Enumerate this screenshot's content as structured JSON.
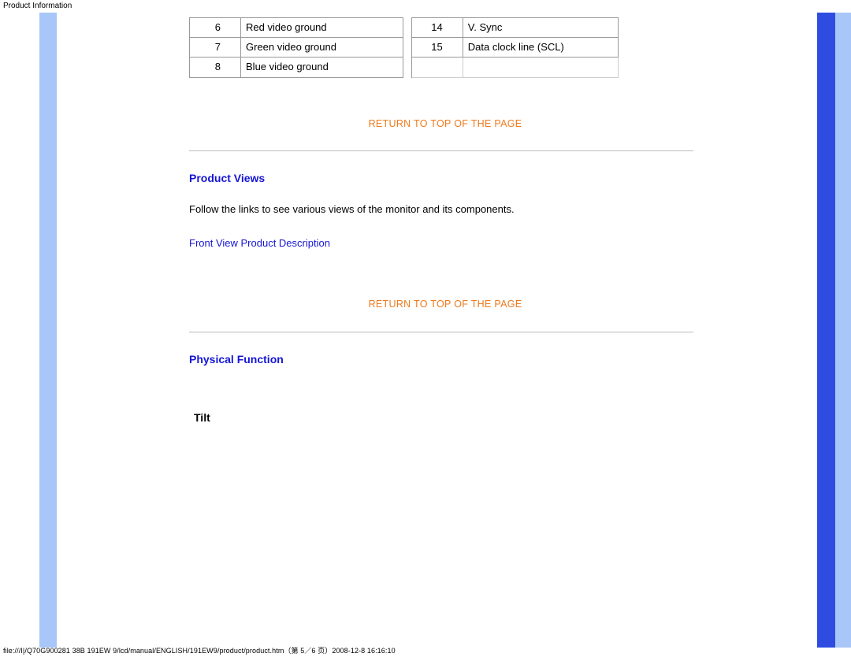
{
  "header": {
    "title": "Product Information"
  },
  "table": {
    "rows": [
      {
        "num1": "6",
        "desc1": "Red video ground",
        "num2": "14",
        "desc2": "V. Sync"
      },
      {
        "num1": "7",
        "desc1": "Green video ground",
        "num2": "15",
        "desc2": "Data clock line (SCL)"
      },
      {
        "num1": "8",
        "desc1": "Blue video ground",
        "num2": "",
        "desc2": ""
      }
    ]
  },
  "links": {
    "return_top": "RETURN TO TOP OF THE PAGE",
    "front_view": "Front View Product Description"
  },
  "sections": {
    "product_views_title": "Product Views",
    "product_views_body": "Follow the links to see various views of the monitor and its components.",
    "physical_function_title": "Physical Function",
    "tilt_label": "Tilt"
  },
  "footer": {
    "path": "file:///I|/Q70G900281 38B 191EW 9/lcd/manual/ENGLISH/191EW9/product/product.htm（第 5／6 页）2008-12-8 16:16:10"
  }
}
